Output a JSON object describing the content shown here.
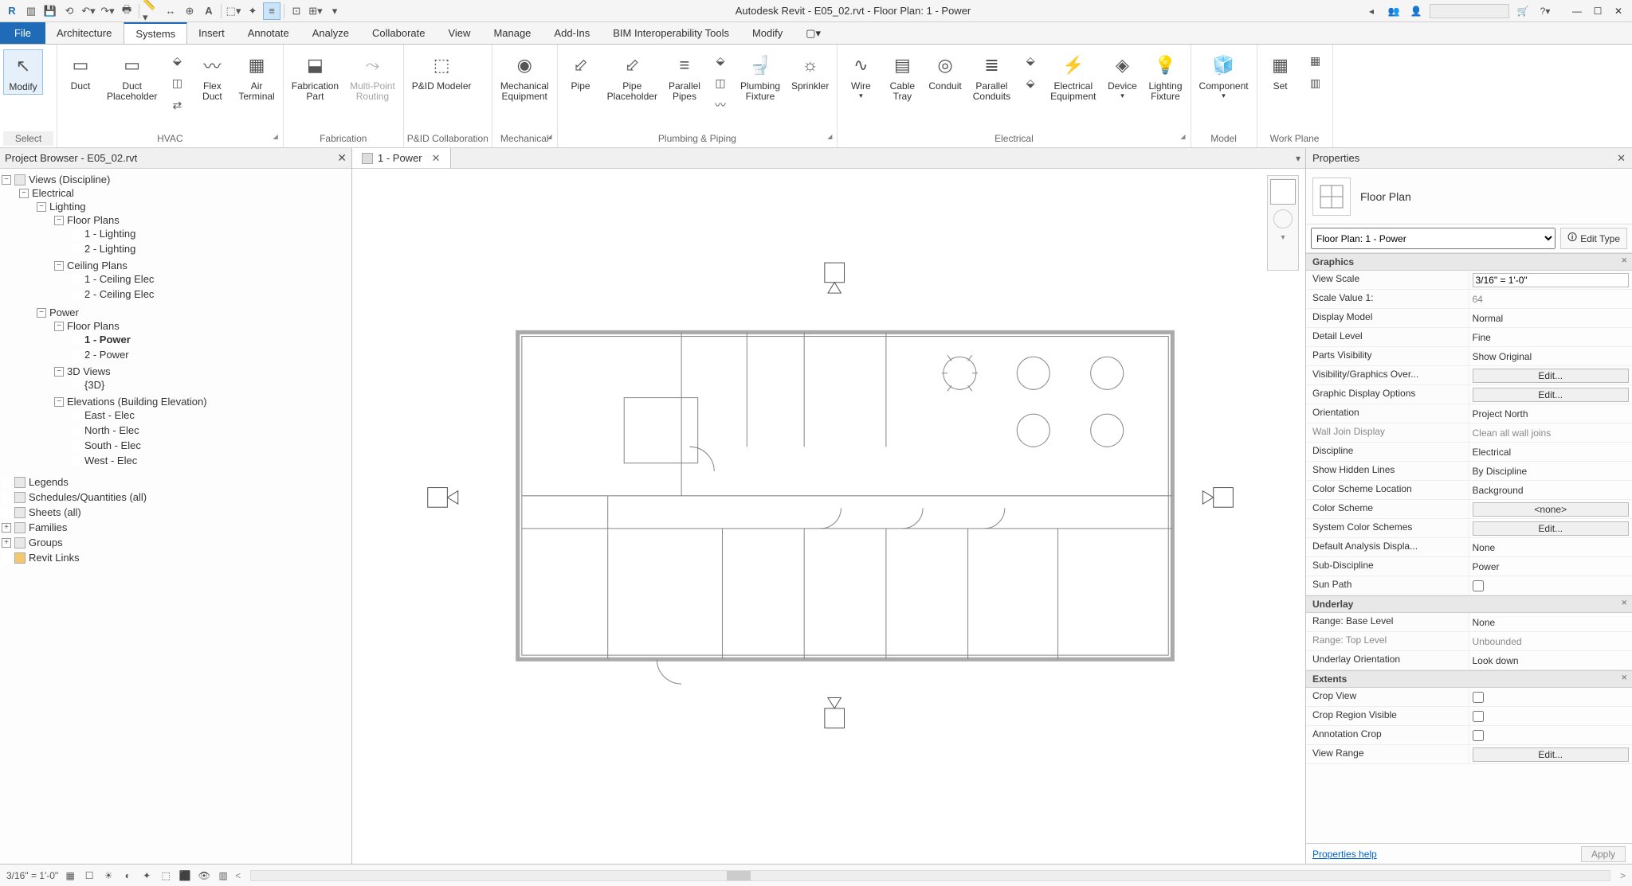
{
  "title": "Autodesk Revit     - E05_02.rvt - Floor Plan: 1 - Power",
  "menu": {
    "file": "File",
    "tabs": [
      "Architecture",
      "Systems",
      "Insert",
      "Annotate",
      "Analyze",
      "Collaborate",
      "View",
      "Manage",
      "Add-Ins",
      "BIM Interoperability Tools",
      "Modify"
    ],
    "active": "Systems"
  },
  "ribbon": {
    "modify": "Modify",
    "select_panel": "Select",
    "hvac_panel": "HVAC",
    "fab_panel": "Fabrication",
    "pid_panel": "P&ID Collaboration",
    "mech_panel": "Mechanical",
    "plumb_panel": "Plumbing & Piping",
    "elec_panel": "Electrical",
    "model_panel": "Model",
    "work_panel": "Work Plane",
    "tools": {
      "duct": "Duct",
      "duct_ph": "Duct\nPlaceholder",
      "flex_duct": "Flex\nDuct",
      "air_term": "Air\nTerminal",
      "fab_part": "Fabrication\nPart",
      "mp_route": "Multi-Point\nRouting",
      "pid": "P&ID Modeler",
      "mech_eq": "Mechanical\nEquipment",
      "pipe": "Pipe",
      "pipe_ph": "Pipe\nPlaceholder",
      "par_pipes": "Parallel\nPipes",
      "plumb_fx": "Plumbing\nFixture",
      "sprinkler": "Sprinkler",
      "wire": "Wire",
      "cable_tray": "Cable\nTray",
      "conduit": "Conduit",
      "par_conduits": "Parallel\nConduits",
      "elec_eq": "Electrical\nEquipment",
      "device": "Device",
      "lighting_fx": "Lighting\nFixture",
      "component": "Component",
      "set": "Set"
    }
  },
  "browser": {
    "title": "Project Browser - E05_02.rvt",
    "root": "Views (Discipline)",
    "tree": {
      "electrical": "Electrical",
      "lighting": "Lighting",
      "floor_plans": "Floor Plans",
      "l1": "1 - Lighting",
      "l2": "2 - Lighting",
      "ceiling_plans": "Ceiling Plans",
      "c1": "1 - Ceiling Elec",
      "c2": "2 - Ceiling Elec",
      "power": "Power",
      "p1": "1 - Power",
      "p2": "2 - Power",
      "views3d": "3D Views",
      "v3d": "{3D}",
      "elevations": "Elevations (Building Elevation)",
      "e1": "East - Elec",
      "e2": "North - Elec",
      "e3": "South - Elec",
      "e4": "West - Elec",
      "legends": "Legends",
      "sched": "Schedules/Quantities (all)",
      "sheets": "Sheets (all)",
      "families": "Families",
      "groups": "Groups",
      "revit_links": "Revit Links"
    }
  },
  "view_tab": {
    "label": "1 - Power"
  },
  "props": {
    "title": "Properties",
    "type_name": "Floor Plan",
    "instance": "Floor Plan: 1 - Power",
    "edit_type": "Edit Type",
    "groups": {
      "graphics": "Graphics",
      "underlay": "Underlay",
      "extents": "Extents"
    },
    "rows": {
      "view_scale": {
        "k": "View Scale",
        "v": "3/16\" = 1'-0\""
      },
      "scale_value": {
        "k": "Scale Value    1:",
        "v": "64"
      },
      "display_model": {
        "k": "Display Model",
        "v": "Normal"
      },
      "detail_level": {
        "k": "Detail Level",
        "v": "Fine"
      },
      "parts_vis": {
        "k": "Parts Visibility",
        "v": "Show Original"
      },
      "vis_over": {
        "k": "Visibility/Graphics Over...",
        "v": "Edit..."
      },
      "gdo": {
        "k": "Graphic Display Options",
        "v": "Edit..."
      },
      "orientation": {
        "k": "Orientation",
        "v": "Project North"
      },
      "wall_join": {
        "k": "Wall Join Display",
        "v": "Clean all wall joins"
      },
      "discipline": {
        "k": "Discipline",
        "v": "Electrical"
      },
      "show_hidden": {
        "k": "Show Hidden Lines",
        "v": "By Discipline"
      },
      "color_loc": {
        "k": "Color Scheme Location",
        "v": "Background"
      },
      "color_scheme": {
        "k": "Color Scheme",
        "v": "<none>"
      },
      "sys_color": {
        "k": "System Color Schemes",
        "v": "Edit..."
      },
      "def_analysis": {
        "k": "Default Analysis Displa...",
        "v": "None"
      },
      "sub_disc": {
        "k": "Sub-Discipline",
        "v": "Power"
      },
      "sun_path": {
        "k": "Sun Path"
      },
      "range_base": {
        "k": "Range: Base Level",
        "v": "None"
      },
      "range_top": {
        "k": "Range: Top Level",
        "v": "Unbounded"
      },
      "underlay_orient": {
        "k": "Underlay Orientation",
        "v": "Look down"
      },
      "crop_view": {
        "k": "Crop View"
      },
      "crop_region": {
        "k": "Crop Region Visible"
      },
      "anno_crop": {
        "k": "Annotation Crop"
      },
      "view_range": {
        "k": "View Range",
        "v": "Edit..."
      }
    },
    "help": "Properties help",
    "apply": "Apply"
  },
  "status": {
    "scale": "3/16\" = 1'-0\""
  }
}
